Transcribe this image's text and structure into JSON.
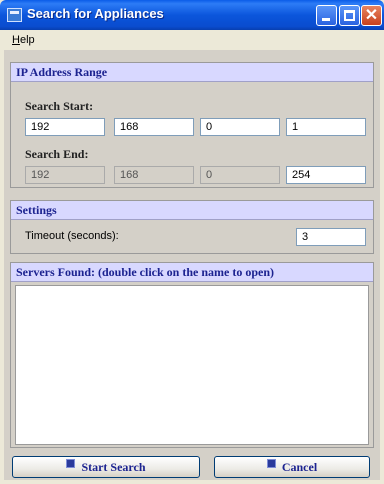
{
  "window": {
    "title": "Search for Appliances"
  },
  "menu": {
    "help_label_accel": "H",
    "help_label_rest": "elp"
  },
  "ip_range": {
    "header": "IP Address Range",
    "start_label": "Search Start:",
    "start": [
      "192",
      "168",
      "0",
      "1"
    ],
    "end_label": "Search End:",
    "end": [
      "192",
      "168",
      "0",
      "254"
    ]
  },
  "settings": {
    "header": "Settings",
    "timeout_label": "Timeout (seconds):",
    "timeout_value": "3"
  },
  "servers": {
    "header": "Servers Found: (double click on the name to open)",
    "items": []
  },
  "buttons": {
    "start": "Start Search",
    "cancel": "Cancel"
  },
  "icons": [
    "app-icon",
    "minimize-icon",
    "maximize-icon",
    "close-icon"
  ],
  "colors": {
    "titlebar": "#0a56dc",
    "group_header_bg": "#d8d8ff",
    "group_header_text": "#1c2390",
    "button_text": "#1c2390"
  }
}
